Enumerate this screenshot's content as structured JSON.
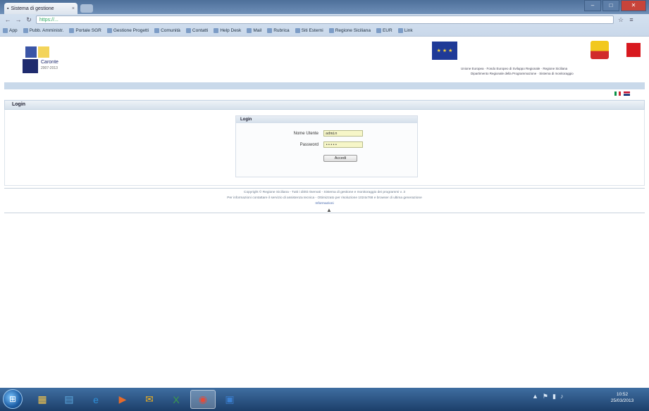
{
  "browser": {
    "tab_title": "Sistema di gestione",
    "tab_close": "×",
    "address": "https://...",
    "window_buttons": [
      "–",
      "□",
      "✕"
    ],
    "nav": {
      "back": "←",
      "forward": "→",
      "reload": "↻",
      "menu": "≡"
    },
    "bookmarks": [
      "App",
      "Pubb. Amministr.",
      "Portale SGR",
      "Gestione Progetti",
      "Comunità",
      "Contatti",
      "Help Desk",
      "Mail",
      "Rubrica",
      "Siti Esterni",
      "Regione Siciliana",
      "EUR",
      "Link"
    ]
  },
  "header": {
    "logo_text": "Caronte",
    "logo_subtext": "2007-2013",
    "eu_label": "★ ★ ★",
    "header_line1": "Unione Europea · Fondo Europeo di Sviluppo Regionale · Regione Siciliana",
    "header_line2": "Dipartimento Regionale della Programmazione · Sistema di monitoraggio"
  },
  "section": {
    "title": "Login"
  },
  "login": {
    "box_title": "Login",
    "username_label": "Nome Utente",
    "username_value": "admin",
    "password_label": "Password",
    "password_value": "•••••",
    "submit_label": "Accedi"
  },
  "footer": {
    "line1": "Copyright © Regione Siciliana - Tutti i diritti riservati - Sistema di gestione e monitoraggio dei programmi v. 3",
    "line2": "Per informazioni contattare il servizio di assistenza tecnica - Ottimizzato per risoluzione 1024x768 e browser di ultima generazione",
    "link": "Informazioni",
    "top_icon": "▲"
  },
  "taskbar": {
    "start": "⊞",
    "apps": [
      {
        "name": "explorer-icon",
        "glyph": "▦"
      },
      {
        "name": "folder-icon",
        "glyph": "▤"
      },
      {
        "name": "internet-explorer-icon",
        "glyph": "e"
      },
      {
        "name": "media-icon",
        "glyph": "▶"
      },
      {
        "name": "outlook-icon",
        "glyph": "✉"
      },
      {
        "name": "excel-icon",
        "glyph": "X"
      },
      {
        "name": "chrome-icon",
        "glyph": "◉"
      },
      {
        "name": "app-window-icon",
        "glyph": "▣"
      }
    ],
    "tray": [
      "▲",
      "⚑",
      "▮",
      "♪"
    ],
    "clock_time": "10:52",
    "clock_date": "25/03/2013"
  },
  "colors": {
    "accent": "#c9d9ea",
    "taskbar": "#1c3f6a",
    "input_bg": "#f6f6c8"
  }
}
